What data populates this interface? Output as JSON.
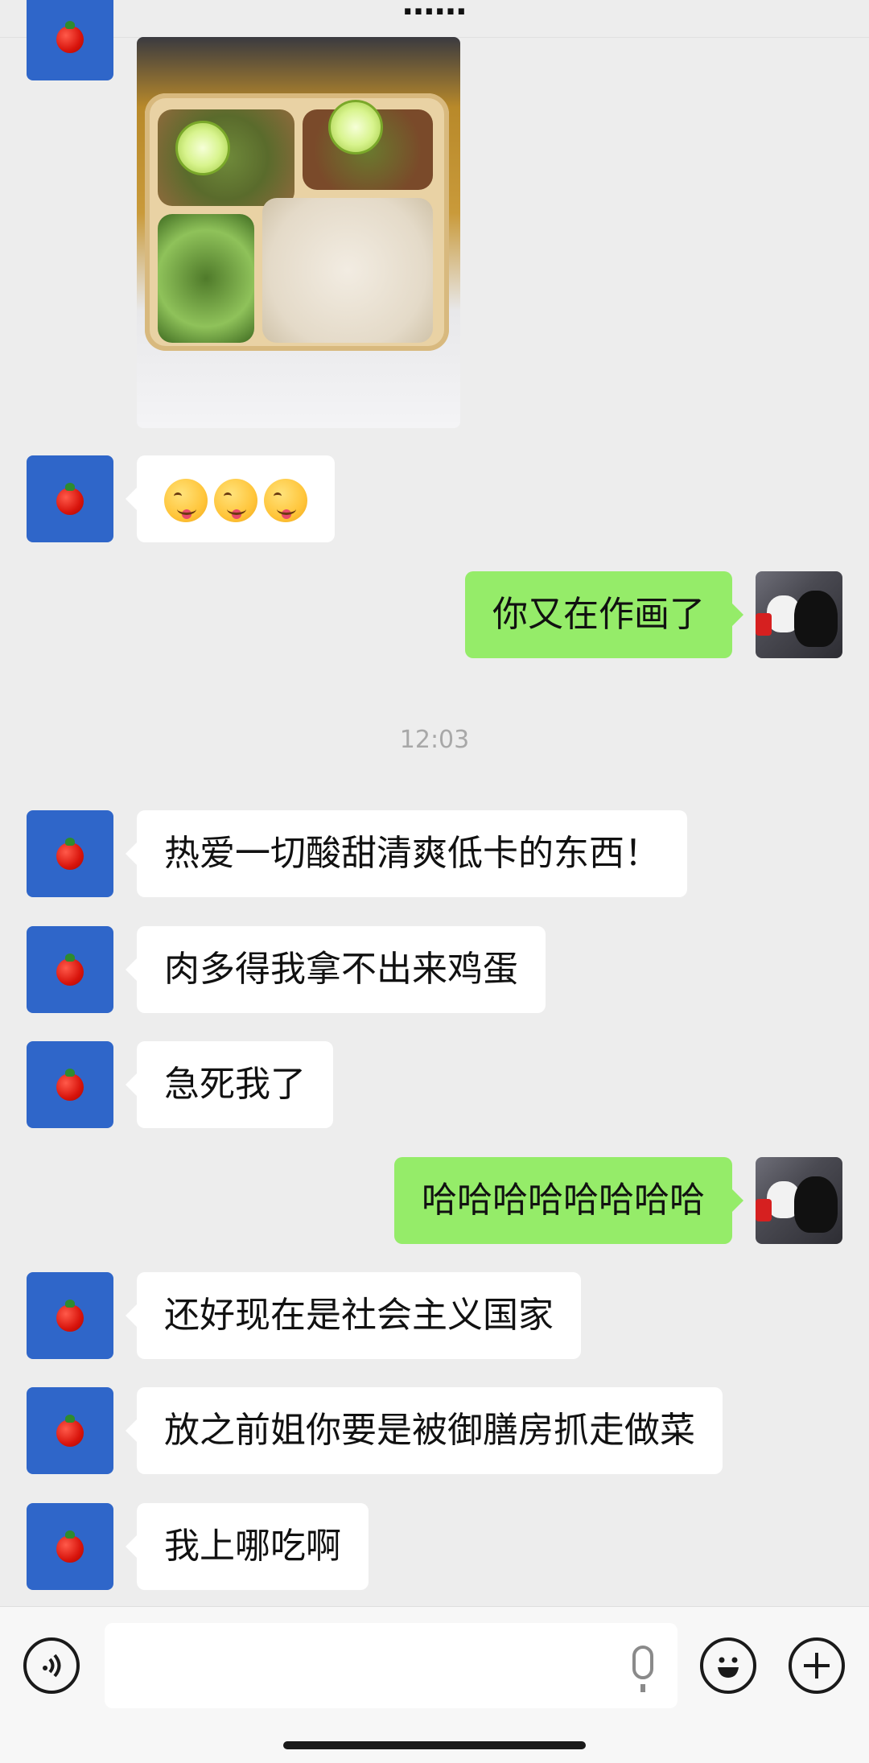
{
  "header": {
    "title": "……",
    "back_icon": "chevron-left-icon"
  },
  "timestamp": "12:03",
  "messages": [
    {
      "side": "left",
      "type": "image",
      "description_icon": "photo"
    },
    {
      "side": "left",
      "type": "emoji",
      "emojis": [
        "😋",
        "😋",
        "😋"
      ]
    },
    {
      "side": "right",
      "type": "text",
      "text": "你又在作画了"
    },
    {
      "side": "left",
      "type": "text",
      "text": "热爱一切酸甜清爽低卡的东西！"
    },
    {
      "side": "left",
      "type": "text",
      "text": "肉多得我拿不出来鸡蛋"
    },
    {
      "side": "left",
      "type": "text",
      "text": "急死我了"
    },
    {
      "side": "right",
      "type": "text",
      "text": "哈哈哈哈哈哈哈哈"
    },
    {
      "side": "left",
      "type": "text",
      "text": "还好现在是社会主义国家"
    },
    {
      "side": "left",
      "type": "text",
      "text": "放之前姐你要是被御膳房抓走做菜"
    },
    {
      "side": "left",
      "type": "text",
      "text": "我上哪吃啊"
    }
  ],
  "input": {
    "placeholder": "",
    "voice_icon": "voice-icon",
    "mic_icon": "microphone-icon",
    "emoji_icon": "emoji-icon",
    "plus_icon": "plus-icon"
  },
  "colors": {
    "background": "#ededed",
    "my_bubble": "#95ec69",
    "their_bubble": "#ffffff",
    "avatar_blue": "#2f66c9"
  }
}
